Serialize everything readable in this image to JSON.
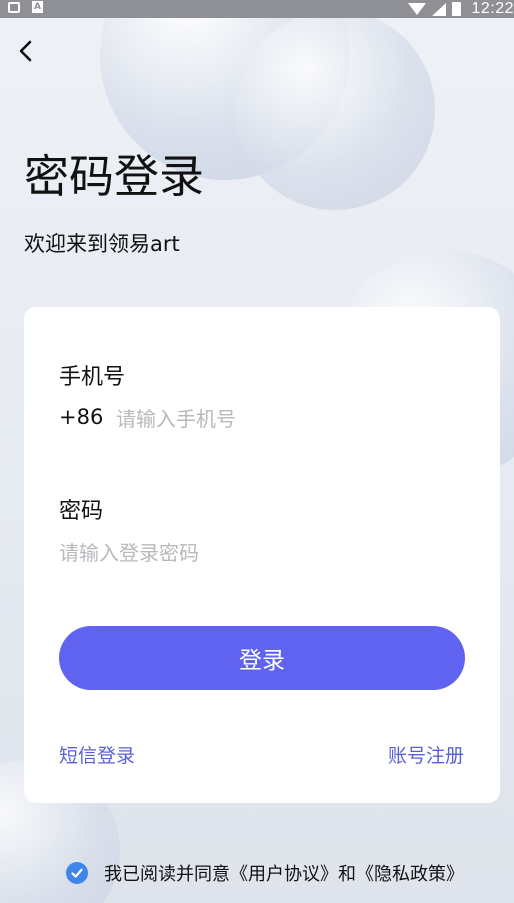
{
  "status_bar": {
    "time": "12:22",
    "icons": [
      "grid-icon",
      "a-badge-icon",
      "wifi-icon",
      "signal-icon",
      "battery-icon"
    ]
  },
  "header": {
    "back_icon": "chevron-left-icon",
    "title": "密码登录",
    "subtitle": "欢迎来到领易art"
  },
  "form": {
    "phone_label": "手机号",
    "country_code": "+86",
    "phone_placeholder": "请输入手机号",
    "phone_value": "",
    "password_label": "密码",
    "password_placeholder": "请输入登录密码",
    "password_value": "",
    "login_button": "登录",
    "sms_login_link": "短信登录",
    "register_link": "账号注册"
  },
  "agreement": {
    "checked": true,
    "text": "我已阅读并同意《用户协议》和《隐私政策》"
  },
  "colors": {
    "accent": "#5f63ef",
    "link": "#5a5fd6",
    "check": "#3f86e8"
  }
}
